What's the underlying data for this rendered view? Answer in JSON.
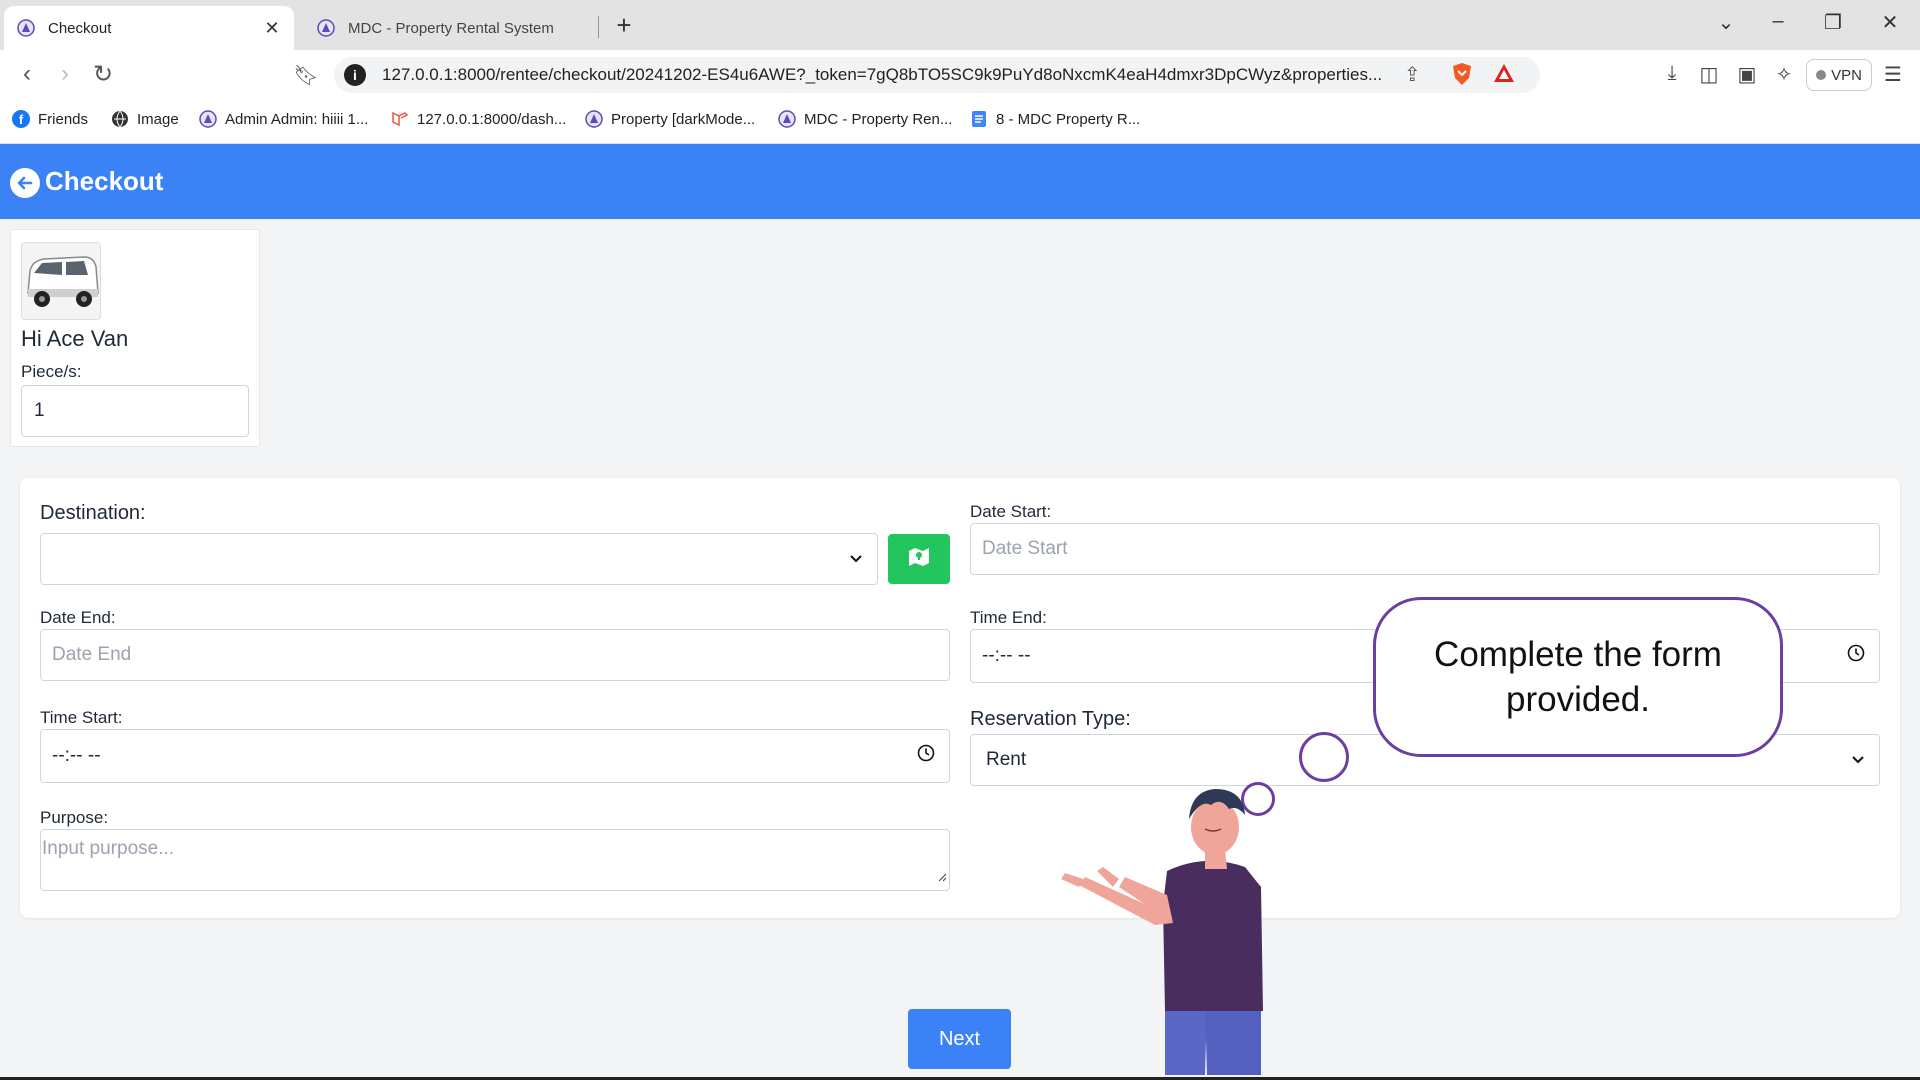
{
  "browser": {
    "tabs": [
      {
        "title": "Checkout",
        "active": true
      },
      {
        "title": "MDC - Property Rental System",
        "active": false
      }
    ],
    "url": "127.0.0.1:8000/rentee/checkout/20241202-ES4u6AWE?_token=7gQ8bTO5SC9k9PuYd8oNxcmK4eaH4dmxr3DpCWyz&properties...",
    "vpn_label": "VPN",
    "bookmarks": [
      {
        "label": "Friends",
        "icon": "facebook-icon"
      },
      {
        "label": "Image",
        "icon": "globe-icon"
      },
      {
        "label": "Admin Admin: hiiii 1...",
        "icon": "app-icon"
      },
      {
        "label": "127.0.0.1:8000/dash...",
        "icon": "laravel-icon"
      },
      {
        "label": "Property [darkMode...",
        "icon": "app-icon"
      },
      {
        "label": "MDC - Property Ren...",
        "icon": "app-icon"
      },
      {
        "label": "8 - MDC Property R...",
        "icon": "doc-icon"
      }
    ]
  },
  "header": {
    "title": "Checkout",
    "color": "#3b82f6"
  },
  "item": {
    "name": "Hi Ace Van",
    "pieces_label": "Piece/s:",
    "pieces_value": "1"
  },
  "form": {
    "destination_label": "Destination:",
    "destination_value": "",
    "date_start_label": "Date Start:",
    "date_start_placeholder": "Date Start",
    "date_end_label": "Date End:",
    "date_end_placeholder": "Date End",
    "time_end_label": "Time End:",
    "time_end_value": "--:-- --",
    "time_start_label": "Time Start:",
    "time_start_value": "--:-- --",
    "reservation_type_label": "Reservation Type:",
    "reservation_type_value": "Rent",
    "purpose_label": "Purpose:",
    "purpose_placeholder": "Input purpose..."
  },
  "next_label": "Next",
  "overlay": {
    "message": "Complete the form provided.",
    "accent": "#6b3fa0"
  },
  "colors": {
    "primary": "#3b82f6",
    "success": "#22c55e"
  }
}
